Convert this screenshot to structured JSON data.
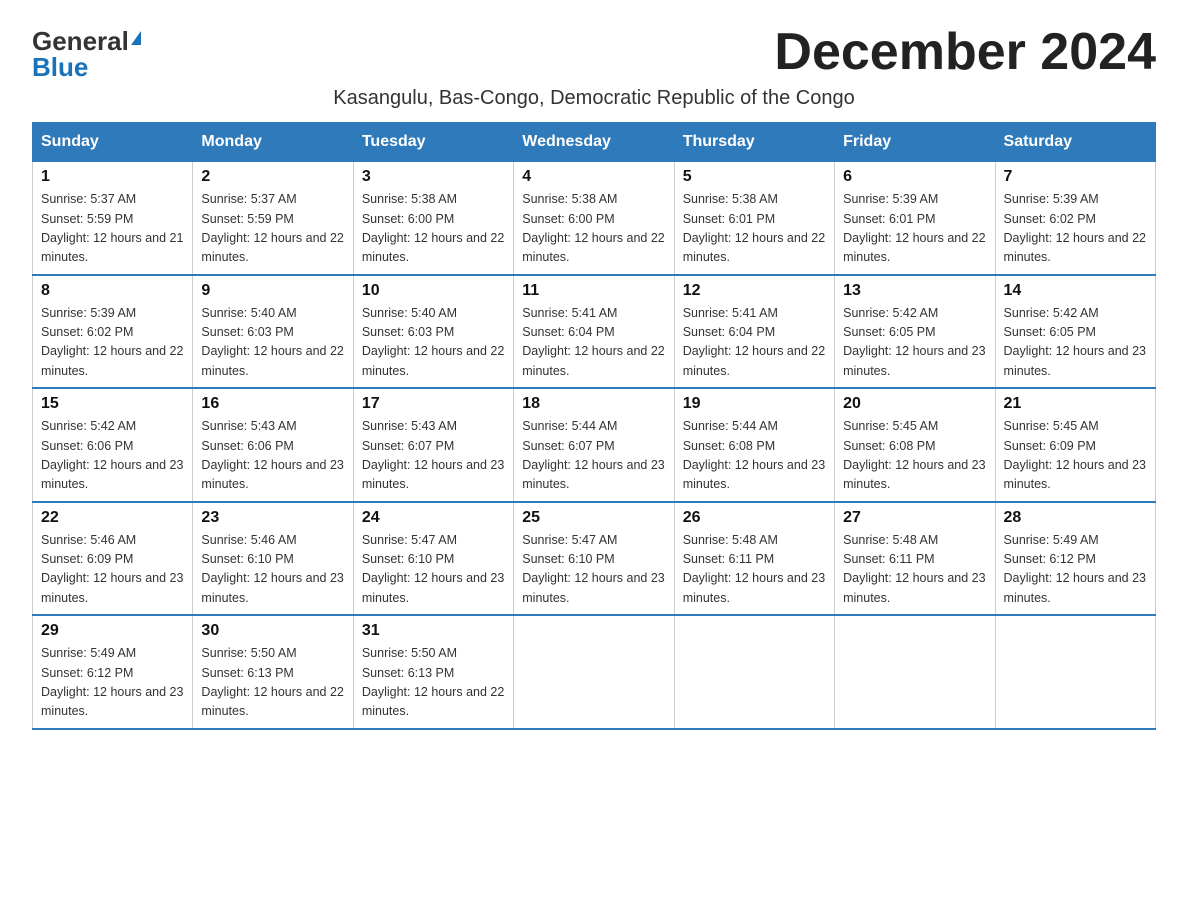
{
  "logo": {
    "general": "General",
    "blue": "Blue"
  },
  "title": "December 2024",
  "subtitle": "Kasangulu, Bas-Congo, Democratic Republic of the Congo",
  "headers": [
    "Sunday",
    "Monday",
    "Tuesday",
    "Wednesday",
    "Thursday",
    "Friday",
    "Saturday"
  ],
  "weeks": [
    [
      {
        "day": "1",
        "sunrise": "5:37 AM",
        "sunset": "5:59 PM",
        "daylight": "12 hours and 21 minutes."
      },
      {
        "day": "2",
        "sunrise": "5:37 AM",
        "sunset": "5:59 PM",
        "daylight": "12 hours and 22 minutes."
      },
      {
        "day": "3",
        "sunrise": "5:38 AM",
        "sunset": "6:00 PM",
        "daylight": "12 hours and 22 minutes."
      },
      {
        "day": "4",
        "sunrise": "5:38 AM",
        "sunset": "6:00 PM",
        "daylight": "12 hours and 22 minutes."
      },
      {
        "day": "5",
        "sunrise": "5:38 AM",
        "sunset": "6:01 PM",
        "daylight": "12 hours and 22 minutes."
      },
      {
        "day": "6",
        "sunrise": "5:39 AM",
        "sunset": "6:01 PM",
        "daylight": "12 hours and 22 minutes."
      },
      {
        "day": "7",
        "sunrise": "5:39 AM",
        "sunset": "6:02 PM",
        "daylight": "12 hours and 22 minutes."
      }
    ],
    [
      {
        "day": "8",
        "sunrise": "5:39 AM",
        "sunset": "6:02 PM",
        "daylight": "12 hours and 22 minutes."
      },
      {
        "day": "9",
        "sunrise": "5:40 AM",
        "sunset": "6:03 PM",
        "daylight": "12 hours and 22 minutes."
      },
      {
        "day": "10",
        "sunrise": "5:40 AM",
        "sunset": "6:03 PM",
        "daylight": "12 hours and 22 minutes."
      },
      {
        "day": "11",
        "sunrise": "5:41 AM",
        "sunset": "6:04 PM",
        "daylight": "12 hours and 22 minutes."
      },
      {
        "day": "12",
        "sunrise": "5:41 AM",
        "sunset": "6:04 PM",
        "daylight": "12 hours and 22 minutes."
      },
      {
        "day": "13",
        "sunrise": "5:42 AM",
        "sunset": "6:05 PM",
        "daylight": "12 hours and 23 minutes."
      },
      {
        "day": "14",
        "sunrise": "5:42 AM",
        "sunset": "6:05 PM",
        "daylight": "12 hours and 23 minutes."
      }
    ],
    [
      {
        "day": "15",
        "sunrise": "5:42 AM",
        "sunset": "6:06 PM",
        "daylight": "12 hours and 23 minutes."
      },
      {
        "day": "16",
        "sunrise": "5:43 AM",
        "sunset": "6:06 PM",
        "daylight": "12 hours and 23 minutes."
      },
      {
        "day": "17",
        "sunrise": "5:43 AM",
        "sunset": "6:07 PM",
        "daylight": "12 hours and 23 minutes."
      },
      {
        "day": "18",
        "sunrise": "5:44 AM",
        "sunset": "6:07 PM",
        "daylight": "12 hours and 23 minutes."
      },
      {
        "day": "19",
        "sunrise": "5:44 AM",
        "sunset": "6:08 PM",
        "daylight": "12 hours and 23 minutes."
      },
      {
        "day": "20",
        "sunrise": "5:45 AM",
        "sunset": "6:08 PM",
        "daylight": "12 hours and 23 minutes."
      },
      {
        "day": "21",
        "sunrise": "5:45 AM",
        "sunset": "6:09 PM",
        "daylight": "12 hours and 23 minutes."
      }
    ],
    [
      {
        "day": "22",
        "sunrise": "5:46 AM",
        "sunset": "6:09 PM",
        "daylight": "12 hours and 23 minutes."
      },
      {
        "day": "23",
        "sunrise": "5:46 AM",
        "sunset": "6:10 PM",
        "daylight": "12 hours and 23 minutes."
      },
      {
        "day": "24",
        "sunrise": "5:47 AM",
        "sunset": "6:10 PM",
        "daylight": "12 hours and 23 minutes."
      },
      {
        "day": "25",
        "sunrise": "5:47 AM",
        "sunset": "6:10 PM",
        "daylight": "12 hours and 23 minutes."
      },
      {
        "day": "26",
        "sunrise": "5:48 AM",
        "sunset": "6:11 PM",
        "daylight": "12 hours and 23 minutes."
      },
      {
        "day": "27",
        "sunrise": "5:48 AM",
        "sunset": "6:11 PM",
        "daylight": "12 hours and 23 minutes."
      },
      {
        "day": "28",
        "sunrise": "5:49 AM",
        "sunset": "6:12 PM",
        "daylight": "12 hours and 23 minutes."
      }
    ],
    [
      {
        "day": "29",
        "sunrise": "5:49 AM",
        "sunset": "6:12 PM",
        "daylight": "12 hours and 23 minutes."
      },
      {
        "day": "30",
        "sunrise": "5:50 AM",
        "sunset": "6:13 PM",
        "daylight": "12 hours and 22 minutes."
      },
      {
        "day": "31",
        "sunrise": "5:50 AM",
        "sunset": "6:13 PM",
        "daylight": "12 hours and 22 minutes."
      },
      null,
      null,
      null,
      null
    ]
  ]
}
